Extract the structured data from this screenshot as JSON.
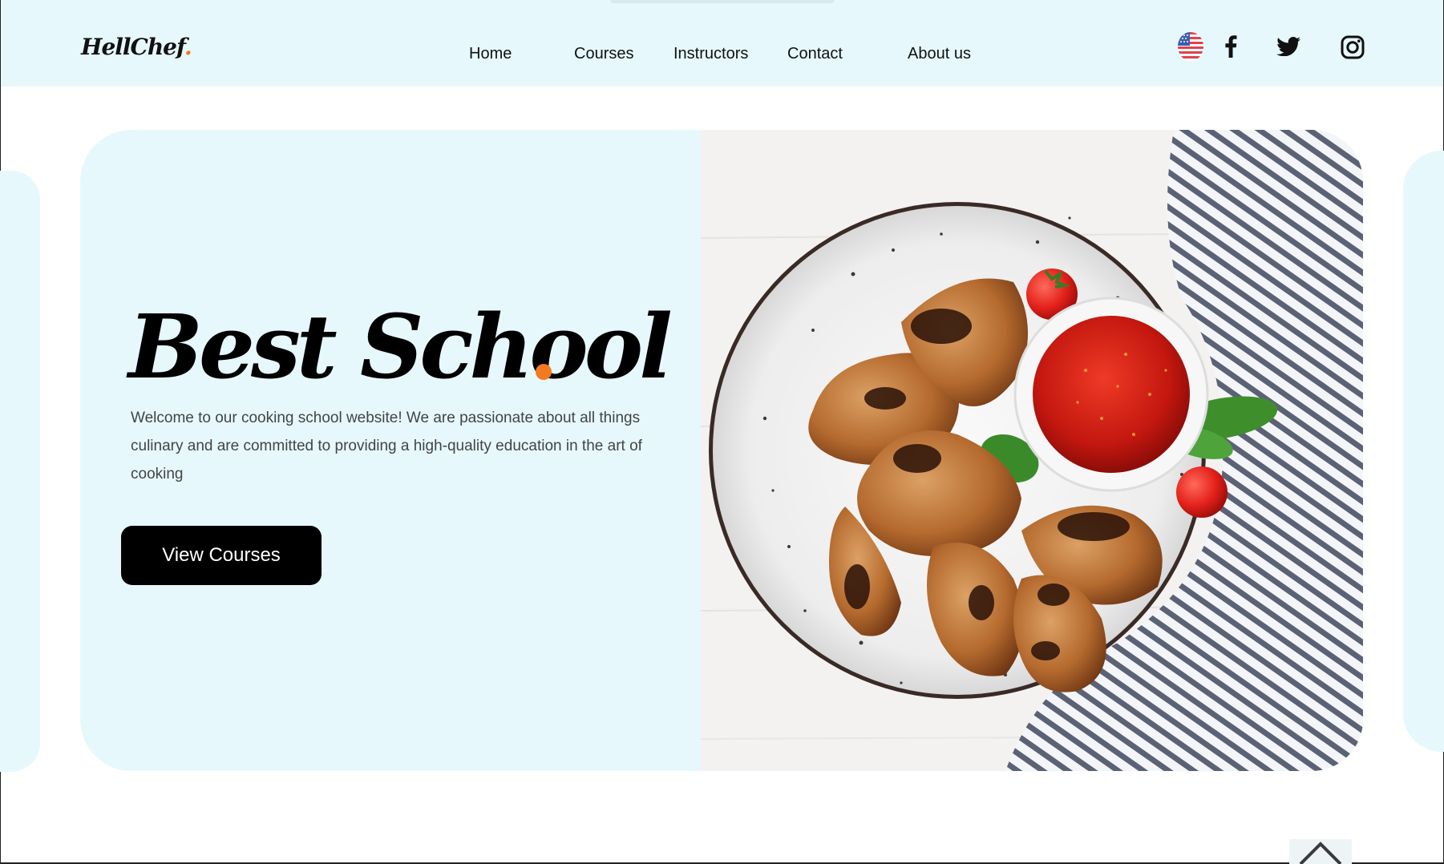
{
  "brand": {
    "name": "HellChef",
    "dot": ".",
    "accent_color": "#f47a20"
  },
  "nav": {
    "items": [
      {
        "label": "Home"
      },
      {
        "label": "Courses"
      },
      {
        "label": "Instructors"
      },
      {
        "label": "Contact"
      },
      {
        "label": "About us"
      }
    ]
  },
  "header_icons": {
    "language": "us-flag-icon",
    "social": [
      "facebook-icon",
      "twitter-icon",
      "instagram-icon"
    ]
  },
  "hero": {
    "title": "Best School",
    "description": "Welcome to our cooking school website! We are passionate about all things culinary and are committed to providing a high-quality education in the art of cooking",
    "cta_label": "View Courses",
    "image": "grilled-chicken-wings-with-tomato-sauce"
  },
  "colors": {
    "header_bg": "#e6f8fc",
    "hero_bg": "#e6f8fc",
    "button_bg": "#000000",
    "button_text": "#ffffff"
  },
  "scroll_top_icon": "chevron-up-icon"
}
